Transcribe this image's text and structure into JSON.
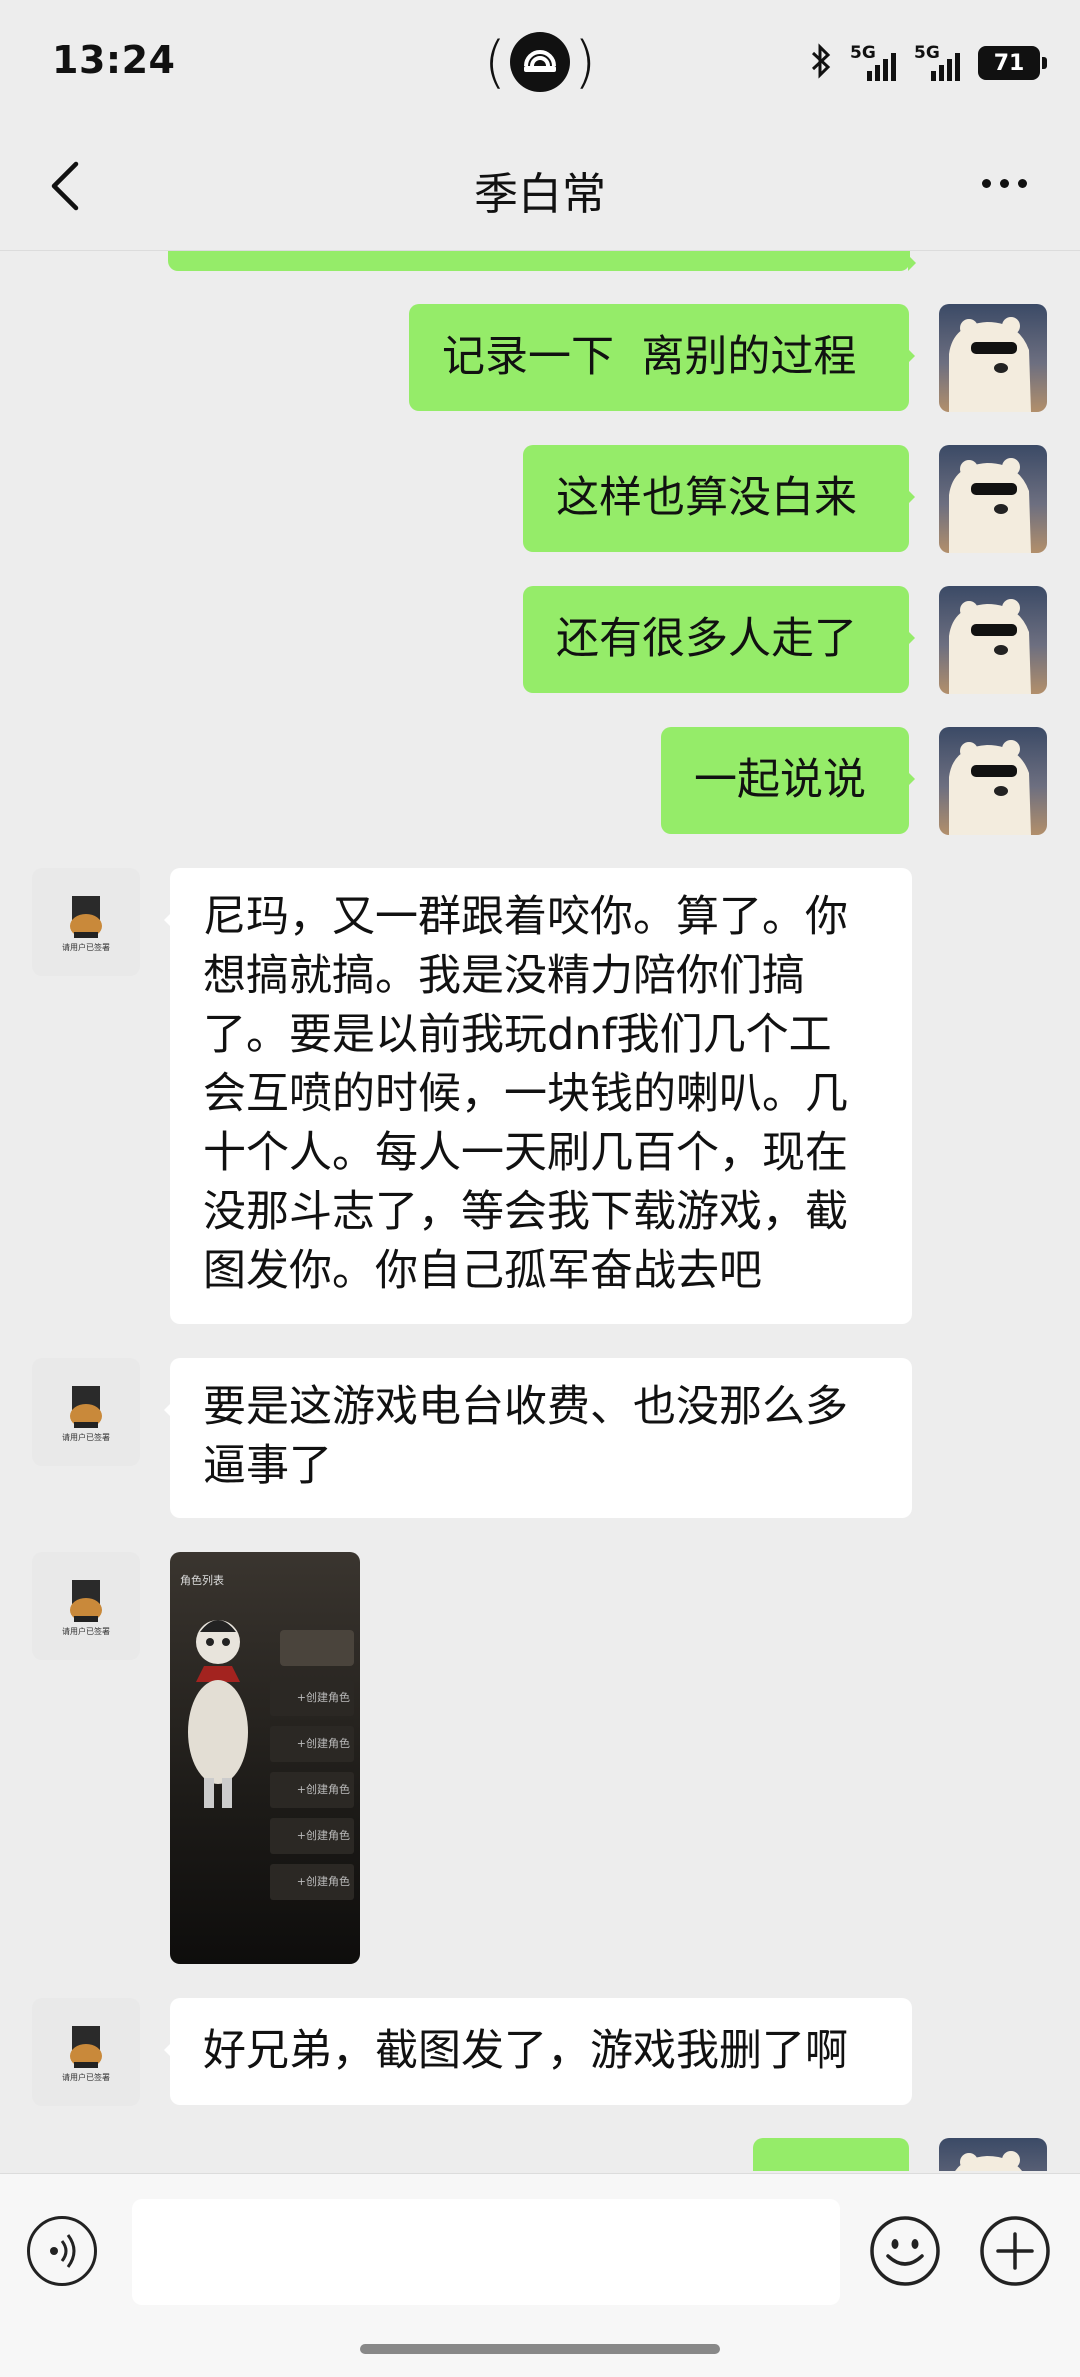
{
  "status": {
    "time": "13:24",
    "signal1": "5G",
    "signal2": "5G",
    "battery": "71"
  },
  "header": {
    "title": "季白常"
  },
  "messages": [
    {
      "from": "me",
      "text": "记录一下  离别的过程"
    },
    {
      "from": "me",
      "text": "这样也算没白来"
    },
    {
      "from": "me",
      "text": "还有很多人走了"
    },
    {
      "from": "me",
      "text": "一起说说"
    },
    {
      "from": "other",
      "lines": [
        "尼玛，又一群跟着咬你。算了。你",
        "想搞就搞。我是没精力陪你们搞",
        "了。要是以前我玩dnf我们几个工",
        "会互喷的时候，一块钱的喇叭。几",
        "十个人。每人一天刷几百个，现在",
        "没那斗志了，等会我下载游戏，截",
        "图发你。你自己孤军奋战去吧"
      ]
    },
    {
      "from": "other",
      "lines": [
        "要是这游戏电台收费、也没那么多",
        "逼事了"
      ]
    },
    {
      "from": "other",
      "type": "image",
      "title": "角色列表",
      "slots": [
        "+创建角色",
        "+创建角色",
        "+创建角色",
        "+创建角色",
        "+创建角色"
      ]
    },
    {
      "from": "other",
      "text": "好兄弟，截图发了，游戏我删了啊"
    }
  ],
  "other_avatar_caption": "请用户已签署",
  "colors": {
    "me_bubble": "#95ec69",
    "other_bubble": "#ffffff",
    "background": "#ededed"
  }
}
